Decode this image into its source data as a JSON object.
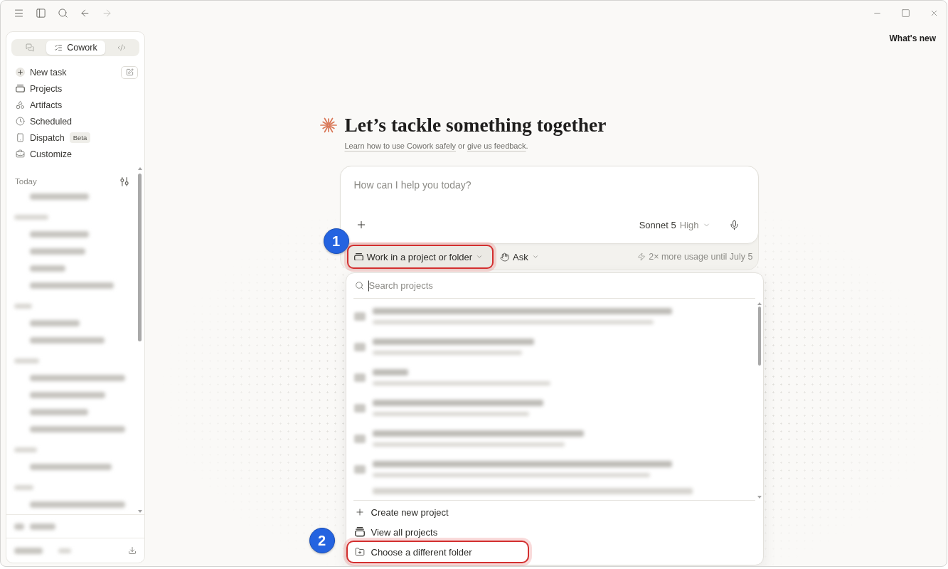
{
  "titlebar": {
    "back": {
      "disabled": false
    },
    "forward": {
      "disabled": true
    }
  },
  "sidebar": {
    "modes": [
      {
        "kind": "chat",
        "selected": false
      },
      {
        "kind": "cowork",
        "label": "Cowork",
        "selected": true
      },
      {
        "kind": "code",
        "selected": false
      }
    ],
    "nav": [
      {
        "kind": "new",
        "label": "New task"
      },
      {
        "kind": "projects",
        "label": "Projects"
      },
      {
        "kind": "artifacts",
        "label": "Artifacts"
      },
      {
        "kind": "scheduled",
        "label": "Scheduled"
      },
      {
        "kind": "dispatch",
        "label": "Dispatch",
        "badge": "Beta"
      },
      {
        "kind": "customize",
        "label": "Customize"
      }
    ],
    "history_heading": "Today"
  },
  "whats_new": "What's new",
  "hero": {
    "title": "Let’s tackle something together",
    "subtitle": [
      {
        "kind": "link",
        "text": "Learn how to use Cowork safely"
      },
      {
        "kind": "plain",
        "text": " or "
      },
      {
        "kind": "link",
        "text": "give us feedback"
      },
      {
        "kind": "plain",
        "text": "."
      }
    ]
  },
  "composer": {
    "placeholder": "How can I help you today?",
    "model": "Sonnet 5",
    "effort": "High",
    "project_button": {
      "label": "Work in a project or folder",
      "highlighted": true,
      "callout": "1"
    },
    "mode_button": {
      "label": "Ask"
    },
    "usage_note": "2× more usage until July 5"
  },
  "project_menu": {
    "search": {
      "placeholder": "Search projects",
      "focused": true
    },
    "actions": [
      {
        "kind": "create",
        "label": "Create new project",
        "highlighted": false
      },
      {
        "kind": "browse",
        "label": "View all projects",
        "highlighted": false
      },
      {
        "kind": "folder",
        "label": "Choose a different folder",
        "highlighted": true,
        "callout": "2"
      }
    ]
  }
}
